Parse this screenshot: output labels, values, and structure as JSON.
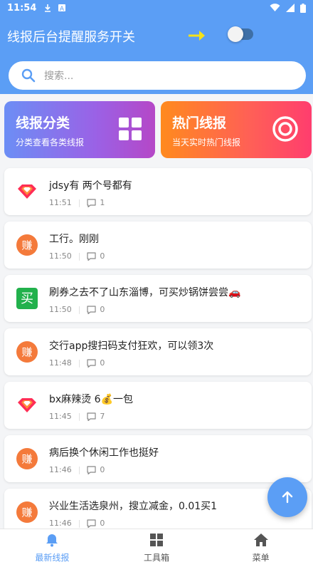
{
  "status_bar": {
    "time": "11:54",
    "icons": [
      "download-icon",
      "a-icon"
    ],
    "right_icons": [
      "wifi-icon",
      "signal-icon",
      "battery-icon"
    ]
  },
  "header": {
    "title": "线报后台提醒服务开关",
    "toggle_on": false
  },
  "search": {
    "placeholder": "搜索..."
  },
  "categories": [
    {
      "title": "线报分类",
      "subtitle": "分类查看各类线报",
      "icon": "grid-icon"
    },
    {
      "title": "热门线报",
      "subtitle": "当天实时热门线报",
      "icon": "target-icon"
    }
  ],
  "items": [
    {
      "avatar": "diamond",
      "text": "jdsy有 两个号都有",
      "time": "11:51",
      "comments": "1"
    },
    {
      "avatar": "zhuan",
      "text": "工行。刚刚",
      "time": "11:50",
      "comments": "0"
    },
    {
      "avatar": "mai",
      "text": "刷券之去不了山东淄博，可买炒锅饼尝尝🚗",
      "time": "11:50",
      "comments": "0"
    },
    {
      "avatar": "zhuan",
      "text": "交行app搜扫码支付狂欢，可以领3次",
      "time": "11:48",
      "comments": "0"
    },
    {
      "avatar": "diamond",
      "text": "bx麻辣烫 6💰一包",
      "time": "11:45",
      "comments": "7"
    },
    {
      "avatar": "zhuan",
      "text": "病后换个休闲工作也挺好",
      "time": "11:46",
      "comments": "0"
    },
    {
      "avatar": "zhuan",
      "text": "兴业生活选泉州，搜立减金，0.01买1",
      "time": "11:46",
      "comments": "0"
    }
  ],
  "avatar_glyphs": {
    "zhuan": "赚",
    "mai": "买"
  },
  "nav": [
    {
      "label": "最新线报",
      "icon": "bell-icon",
      "active": true
    },
    {
      "label": "工具箱",
      "icon": "grid-icon",
      "active": false
    },
    {
      "label": "菜单",
      "icon": "home-icon",
      "active": false
    }
  ],
  "colors": {
    "primary": "#5b9ef5",
    "arrow": "#f5e21a",
    "zhuan": "#f47a3b",
    "mai": "#22b14c"
  }
}
